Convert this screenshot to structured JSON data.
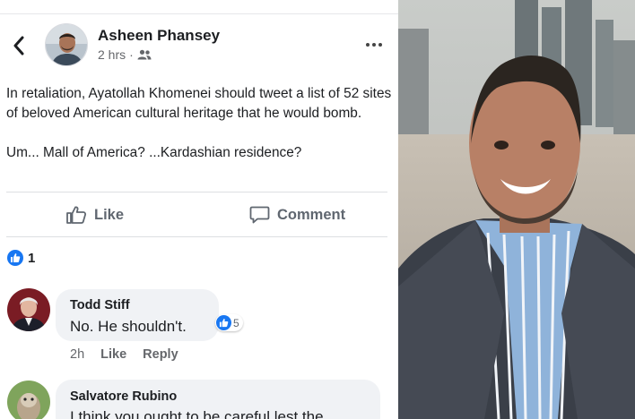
{
  "post": {
    "author": "Asheen Phansey",
    "time": "2 hrs",
    "separator": "·",
    "audience_icon": "friends-icon",
    "text_paragraphs": [
      "In retaliation, Ayatollah Khomenei should tweet a list of 52 sites of beloved American cultural heritage that he would bomb.",
      "Um... Mall of America? ...Kardashian residence?"
    ]
  },
  "actions": {
    "like_label": "Like",
    "comment_label": "Comment"
  },
  "reactions": {
    "count": "1",
    "icon": "thumbs-up-icon"
  },
  "comments": [
    {
      "author": "Todd Stiff",
      "text": "No. He shouldn't.",
      "reaction_count": "5",
      "time": "2h",
      "like_label": "Like",
      "reply_label": "Reply"
    },
    {
      "author": "Salvatore Rubino",
      "text": "I think you ought to be careful lest the"
    }
  ],
  "colors": {
    "facebook_blue": "#1877f2",
    "bubble_gray": "#f0f2f5",
    "secondary_text": "#65676b"
  }
}
